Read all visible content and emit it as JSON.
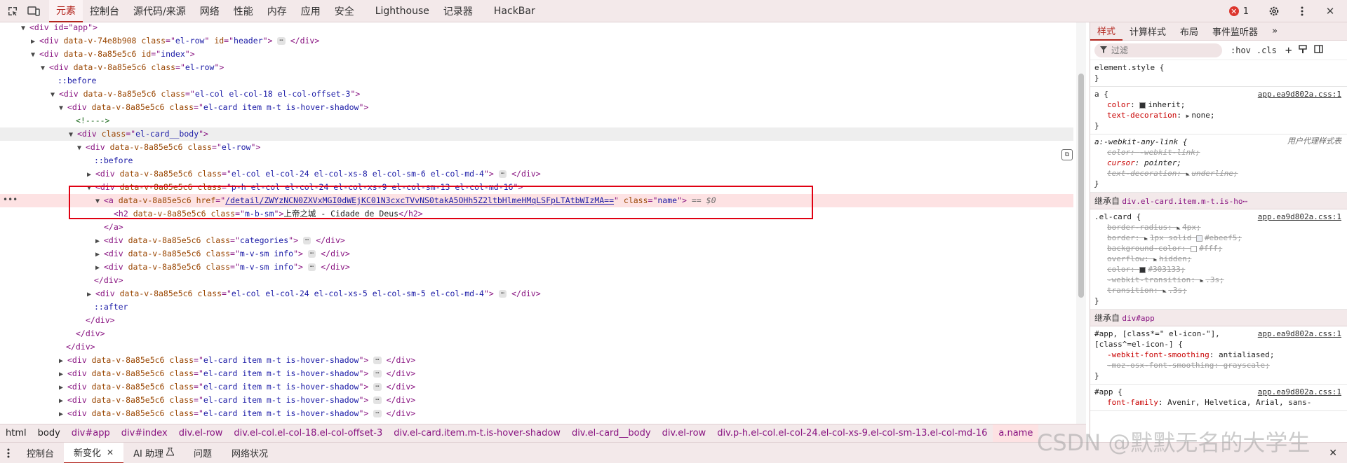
{
  "toolbar": {
    "tabs": [
      "元素",
      "控制台",
      "源代码/来源",
      "网络",
      "性能",
      "内存",
      "应用",
      "安全",
      "Lighthouse",
      "记录器",
      "HackBar"
    ],
    "active_tab": "元素",
    "error_count": "1"
  },
  "dom": {
    "app_open": "<div id=\"app\">",
    "header": {
      "tag": "div",
      "scope": "data-v-74e8b908",
      "class": "el-row",
      "id": "header"
    },
    "index": {
      "tag": "div",
      "scope": "data-v-8a85e5c6",
      "id": "index"
    },
    "scope": "data-v-8a85e5c6",
    "row_class": "el-row",
    "before": "::before",
    "after": "::after",
    "col_offset_class": "el-col el-col-18 el-col-offset-3",
    "card_class": "el-card item m-t is-hover-shadow",
    "comment": "<!---->",
    "card_body_class": "el-card__body",
    "col4_class": "el-col el-col-24 el-col-xs-8 el-col-sm-6 el-col-md-4",
    "col16_class": "p-h el-col el-col-24 el-col-xs-9 el-col-sm-13 el-col-md-16",
    "link_href": "/detail/ZWYzNCN0ZXVxMGI0dWEjKC01N3cxcTVvNS0takA5OHh5Z2ltbHlmeHMqLSFpLTAtbWIzMA==",
    "link_class": "name",
    "eq0": "== $0",
    "h2_class": "m-b-sm",
    "h2_text": "上帝之城 - Cidade de Deus",
    "categories_class": "categories",
    "info_class": "m-v-sm info",
    "col5_class": "el-col el-col-24 el-col-xs-5 el-col-sm-5 el-col-md-4",
    "extra_card_count": 5
  },
  "breadcrumb": [
    "html",
    "body",
    "div#app",
    "div#index",
    "div.el-row",
    "div.el-col.el-col-18.el-col-offset-3",
    "div.el-card.item.m-t.is-hover-shadow",
    "div.el-card__body",
    "div.el-row",
    "div.p-h.el-col.el-col-24.el-col-xs-9.el-col-sm-13.el-col-md-16",
    "a.name"
  ],
  "drawer": {
    "tabs": [
      "控制台",
      "新变化",
      "AI 助理",
      "问题",
      "网络状况"
    ],
    "active": "新变化"
  },
  "styles": {
    "tabs": [
      "样式",
      "计算样式",
      "布局",
      "事件监听器"
    ],
    "filter_placeholder": "过滤",
    "hov": ":hov",
    "cls": ".cls",
    "element_style": "element.style {",
    "rule_a": {
      "selector": "a {",
      "source": "app.ea9d802a.css:1",
      "props": [
        {
          "name": "color",
          "value": "inherit",
          "swatch": "#303133"
        },
        {
          "name": "text-decoration",
          "value": "none"
        }
      ]
    },
    "rule_ua": {
      "selector": "a:-webkit-any-link {",
      "source": "用户代理样式表",
      "props": [
        {
          "name": "color",
          "value": "-webkit-link"
        },
        {
          "name": "cursor",
          "value": "pointer"
        },
        {
          "name": "text-decoration",
          "value": "underline"
        }
      ]
    },
    "inherit1": {
      "label": "继承自",
      "tag": "div.el-card.item.m-t.is-ho⋯"
    },
    "rule_card": {
      "selector": ".el-card {",
      "source": "app.ea9d802a.css:1",
      "props": [
        {
          "name": "border-radius",
          "value": "4px"
        },
        {
          "name": "border",
          "value": "1px solid",
          "swatch": "#ebeef5",
          "color_text": "#ebeef5"
        },
        {
          "name": "background-color",
          "value": "#fff",
          "swatch": "#ffffff"
        },
        {
          "name": "overflow",
          "value": "hidden"
        },
        {
          "name": "color",
          "value": "#303133",
          "swatch": "#303133"
        },
        {
          "name": "-webkit-transition",
          "value": ".3s"
        },
        {
          "name": "transition",
          "value": ".3s"
        }
      ]
    },
    "inherit2": {
      "label": "继承自",
      "tag": "div#app"
    },
    "rule_icon": {
      "selector1": "#app, [class*=\" el-icon-\"],",
      "selector2": "[class^=el-icon-] {",
      "source": "app.ea9d802a.css:1",
      "props": [
        {
          "name": "-webkit-font-smoothing",
          "value": "antialiased"
        },
        {
          "name": "-moz-osx-font-smoothing",
          "value": "grayscale"
        }
      ]
    },
    "rule_app": {
      "selector": "#app {",
      "source": "app.ea9d802a.css:1",
      "props": [
        {
          "name": "font-family",
          "value": "Avenir, Helvetica, Arial, sans-"
        }
      ]
    }
  },
  "watermark": "CSDN @默默无名的大学生"
}
